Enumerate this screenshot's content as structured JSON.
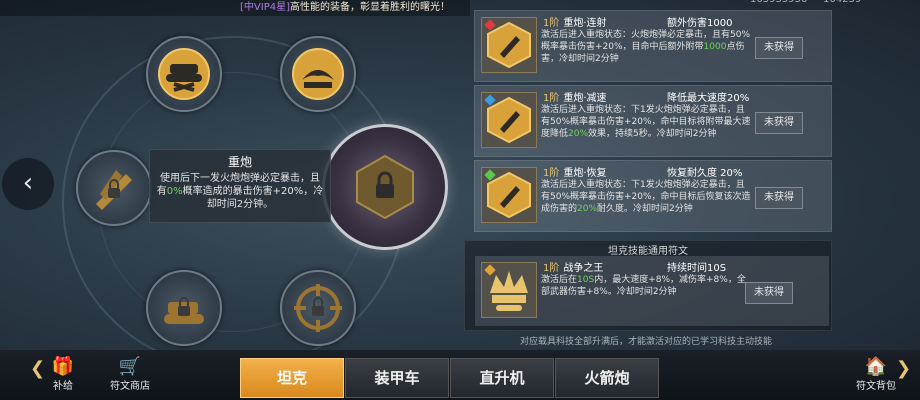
{
  "ticker": {
    "highlight": "[中VIP4星]",
    "message": "高性能的装备，彰显着胜利的曙光！"
  },
  "top_numbers": {
    "left": "163933936",
    "right": "104259"
  },
  "wheel": {
    "nodes": [
      {
        "name": "tank-repair",
        "icon": "tank-wrench-icon"
      },
      {
        "name": "tank-eagle",
        "icon": "eagle-icon"
      },
      {
        "name": "rockets",
        "icon": "rocket-lock-icon"
      },
      {
        "name": "tank-locked",
        "icon": "tank-lock-icon"
      },
      {
        "name": "target",
        "icon": "crosshair-lock-icon"
      }
    ],
    "center_icon": "cannon-lock-icon"
  },
  "tooltip": {
    "title": "重炮",
    "body_pre": "使用后下一发火炮炮弹必定暴击，且有",
    "body_pct": "0%",
    "body_post": "概率造成的暴击伤害+20%，冷却时间2分钟。"
  },
  "cards": [
    {
      "level": "1阶",
      "name": "重炮·连射",
      "stat": "额外伤害1000",
      "gem_color": "#e03a3a",
      "desc_pre": "激活后进入重炮状态：火炮炮弹必定暴击，且有50%概率暴击伤害+20%，目命中后额外附带",
      "desc_hl": "1000",
      "desc_post": "点伤害，冷却时间2分钟",
      "button": "未获得"
    },
    {
      "level": "1阶",
      "name": "重炮·减速",
      "stat": "降低最大速度20%",
      "gem_color": "#3a9de0",
      "desc_pre": "激活后进入重炮状态：下1发火炮炮弹必定暴击，且有50%概率暴击伤害+20%，命中目标将附带最大速度降低",
      "desc_hl": "20%",
      "desc_post": "效果，持续5秒。冷却时间2分钟",
      "button": "未获得"
    },
    {
      "level": "1阶",
      "name": "重炮·恢复",
      "stat": "恢复耐久度 20%",
      "gem_color": "#5ac84a",
      "desc_pre": "激活后进入重炮状态：下1发火炮炮弹必定暴击，且有50%概率暴击伤害+20%，命中目标后恢复该次造成伤害的",
      "desc_hl": "20%",
      "desc_post": "耐久度。冷却时间2分钟",
      "button": "未获得"
    }
  ],
  "common": {
    "header": "坦克技能通用符文",
    "card": {
      "level": "1阶",
      "name": "战争之王",
      "stat": "持续时间10S",
      "gem_color": "#e0a33a",
      "desc_pre": "激活后在",
      "desc_hl": "10S",
      "desc_post": "内，最大速度+8%，减伤率+8%，全部武器伤害+8%。冷却时间2分钟",
      "button": "未获得"
    }
  },
  "footnote": "对应载具科技全部升满后，才能激活对应的已学习科技主动技能",
  "bottom": {
    "left_items": [
      {
        "label": "补给",
        "icon": "gift-box-icon"
      },
      {
        "label": "符文商店",
        "icon": "cart-icon"
      }
    ],
    "tabs": [
      "坦克",
      "装甲车",
      "直升机",
      "火箭炮"
    ],
    "active_tab": 0,
    "right_item": {
      "label": "符文背包",
      "icon": "bag-icon"
    }
  }
}
